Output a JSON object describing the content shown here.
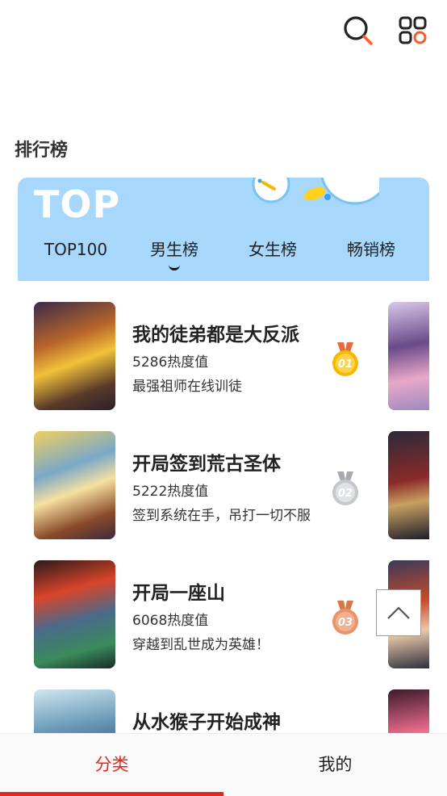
{
  "header": {
    "search_icon": "search-icon",
    "menu_icon": "grid-menu-icon"
  },
  "section_title": "排行榜",
  "ranking": {
    "logo": "TOP",
    "tabs": [
      {
        "label": "TOP100"
      },
      {
        "label": "男生榜",
        "active": true
      },
      {
        "label": "女生榜"
      },
      {
        "label": "畅销榜"
      }
    ],
    "items": [
      {
        "title": "我的徒弟都是大反派",
        "heat": "5286热度值",
        "desc": "最强祖师在线训徒",
        "medal": "01",
        "medal_color": "#f5b800"
      },
      {
        "title": "开局签到荒古圣体",
        "heat": "5222热度值",
        "desc": "签到系统在手，吊打一切不服",
        "medal": "02",
        "medal_color": "#c0c4c8"
      },
      {
        "title": "开局一座山",
        "heat": "6068热度值",
        "desc": "穿越到乱世成为英雄！",
        "medal": "03",
        "medal_color": "#e8946a"
      },
      {
        "title": "从水猴子开始成神",
        "heat": "",
        "desc": "",
        "medal": "",
        "medal_color": "#cccccc"
      }
    ]
  },
  "back_to_top_icon": "chevron-up-icon",
  "bottom_nav": {
    "tabs": [
      {
        "label": "分类",
        "active": true
      },
      {
        "label": "我的"
      }
    ],
    "accent": "#e02a1d"
  }
}
